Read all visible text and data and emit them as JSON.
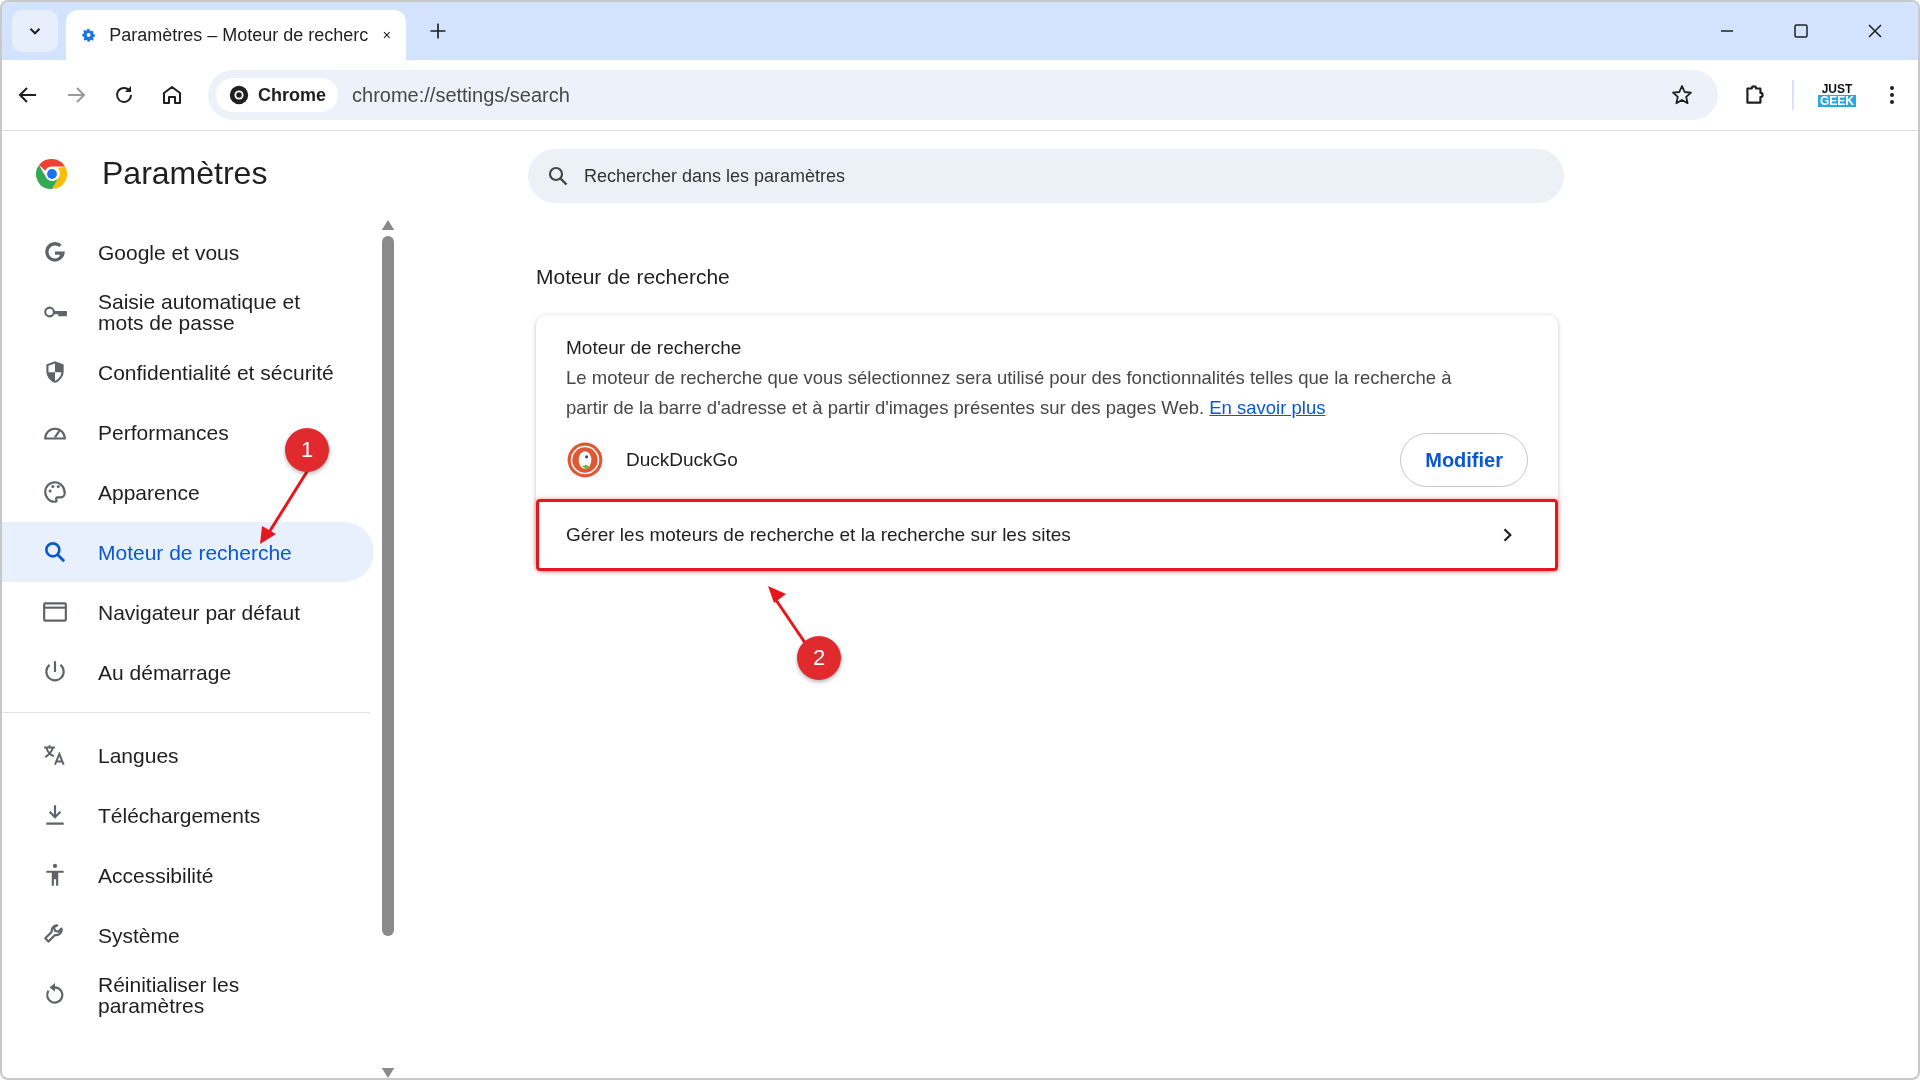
{
  "tabs": [
    {
      "title": "Paramètres – Moteur de recherc",
      "selected": true
    }
  ],
  "toolbar": {
    "site_chip": "Chrome",
    "url": "chrome://settings/search",
    "profile_logo": [
      "JUST",
      "GEEK"
    ]
  },
  "sidebar": {
    "title": "Paramètres",
    "groups": [
      {
        "items": [
          {
            "label": "Google et vous",
            "selected": false
          },
          {
            "label": "Saisie automatique et mots de passe",
            "selected": false
          },
          {
            "label": "Confidentialité et sécurité",
            "selected": false
          },
          {
            "label": "Performances",
            "selected": false
          },
          {
            "label": "Apparence",
            "selected": false
          },
          {
            "label": "Moteur de recherche",
            "selected": true
          },
          {
            "label": "Navigateur par défaut",
            "selected": false
          },
          {
            "label": "Au démarrage",
            "selected": false
          }
        ]
      },
      {
        "items": [
          {
            "label": "Langues",
            "selected": false
          },
          {
            "label": "Téléchargements",
            "selected": false
          },
          {
            "label": "Accessibilité",
            "selected": false
          },
          {
            "label": "Système",
            "selected": false
          },
          {
            "label": "Réinitialiser les paramètres",
            "selected": false
          }
        ]
      }
    ]
  },
  "search": {
    "placeholder": "Rechercher dans les paramètres"
  },
  "section": {
    "heading": "Moteur de recherche",
    "card": {
      "title": "Moteur de recherche",
      "description": "Le moteur de recherche que vous sélectionnez sera utilisé pour des fonctionnalités telles que la recherche à partir de la barre d'adresse et à partir d'images présentes sur des pages Web.",
      "link": "En savoir plus",
      "engine": "DuckDuckGo",
      "button": "Modifier",
      "manage_row": {
        "label": "Gérer les moteurs de recherche et la recherche sur les sites",
        "highlighted": true
      }
    }
  },
  "annotations": [
    {
      "number": "1"
    },
    {
      "number": "2"
    }
  ]
}
